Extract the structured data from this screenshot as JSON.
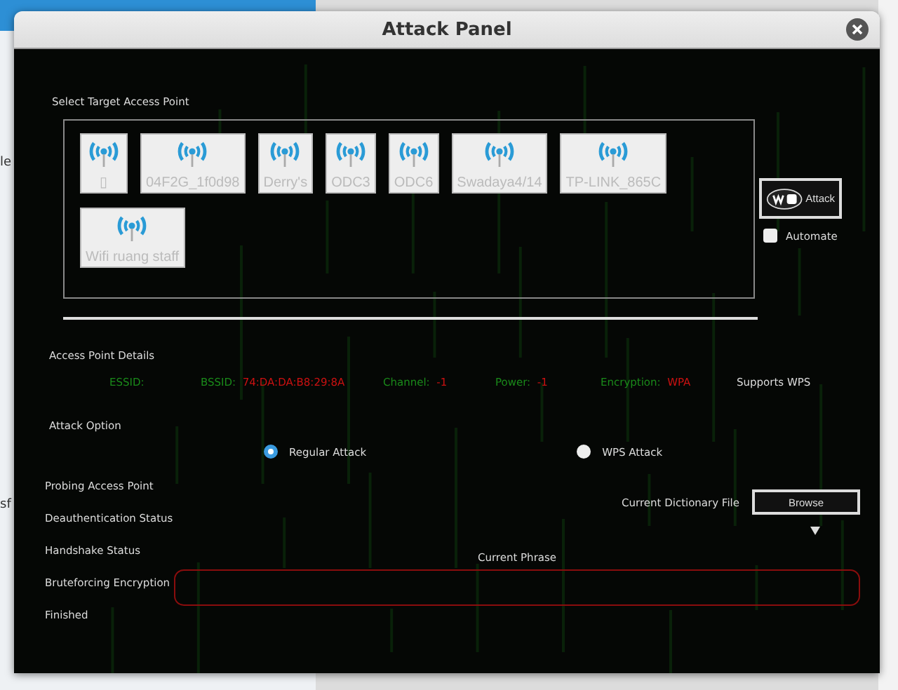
{
  "desktop": {
    "left_fragments": [
      "le",
      "sf"
    ]
  },
  "window": {
    "title": "Attack Panel"
  },
  "target_section": {
    "label": "Select Target Access Point",
    "access_points": [
      {
        "name": "▯"
      },
      {
        "name": "04F2G_1f0d98"
      },
      {
        "name": "Derry's"
      },
      {
        "name": "ODC3"
      },
      {
        "name": "ODC6"
      },
      {
        "name": "Swadaya4/14"
      },
      {
        "name": "TP-LINK_865C"
      },
      {
        "name": "Wifi ruang staff"
      }
    ]
  },
  "attack_button": {
    "label": "Attack"
  },
  "automate": {
    "label": "Automate",
    "checked": false
  },
  "details": {
    "heading": "Access Point Details",
    "fields": [
      {
        "label": "ESSID:"
      },
      {
        "label": "BSSID:",
        "value": "74:DA:DA:B8:29:8A"
      },
      {
        "label": "Channel:",
        "value": "-1"
      },
      {
        "label": "Power:",
        "value": "-1"
      },
      {
        "label": "Encryption:",
        "value": "WPA"
      }
    ],
    "wps_note": "Supports WPS"
  },
  "attack_option": {
    "heading": "Attack Option",
    "options": [
      {
        "label": "Regular Attack",
        "selected": true
      },
      {
        "label": "WPS  Attack",
        "selected": false
      }
    ]
  },
  "status_steps": [
    "Probing Access Point",
    "Deauthentication Status",
    "Handshake Status",
    "Bruteforcing Encryption",
    "Finished"
  ],
  "dictionary": {
    "label": "Current Dictionary File",
    "button": "Browse"
  },
  "phrase": {
    "label": "Current Phrase"
  }
}
